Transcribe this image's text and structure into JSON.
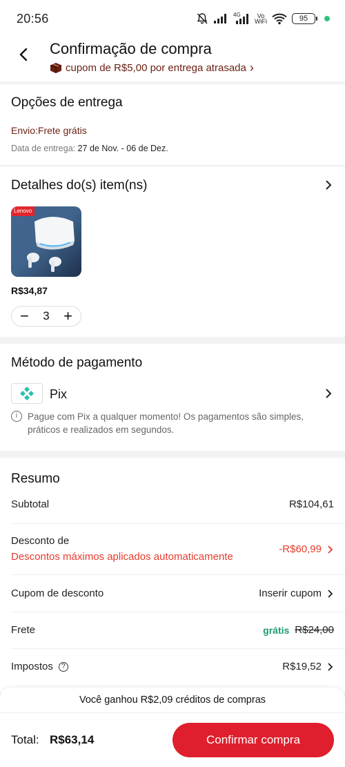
{
  "status_bar": {
    "time": "20:56",
    "network_label": "4G",
    "vowifi_top": "Vo",
    "vowifi_bottom": "WiFi",
    "battery": "95"
  },
  "header": {
    "title": "Confirmação de compra",
    "coupon_text": "cupom de R$5,00 por entrega atrasada",
    "coupon_chevron": "›"
  },
  "delivery": {
    "title": "Opções de entrega",
    "shipping": "Envio:Frete grátis",
    "date_label": "Data de entrega:",
    "date_value": "27 de Nov. - 06 de Dez."
  },
  "items": {
    "title": "Detalhes do(s) item(ns)",
    "product_brand": "Lenovo",
    "price": "R$34,87",
    "quantity": "3",
    "minus": "−",
    "plus": "+"
  },
  "payment": {
    "title": "Método de pagamento",
    "method": "Pix",
    "info": "Pague com Pix a qualquer momento! Os pagamentos são simples, práticos e realizados em segundos."
  },
  "summary": {
    "title": "Resumo",
    "subtotal_label": "Subtotal",
    "subtotal_value": "R$104,61",
    "discount_label": "Desconto de",
    "discount_note": "Descontos máximos aplicados automaticamente",
    "discount_value": "-R$60,99",
    "coupon_label": "Cupom de desconto",
    "coupon_value": "Inserir cupom",
    "shipping_label": "Frete",
    "shipping_free": "grátis",
    "shipping_old": "R$24,00",
    "taxes_label": "Impostos",
    "taxes_value": "R$19,52"
  },
  "credits_banner": "Você ganhou R$2,09 créditos de compras",
  "bottom": {
    "total_label": "Total:",
    "total_value": "R$63,14",
    "confirm_label": "Confirmar compra"
  },
  "colors": {
    "accent_red": "#df1f2d",
    "discount_red": "#e63b2e",
    "brand_brown": "#6a1f13",
    "free_green": "#1e9b6b",
    "pix_teal": "#32bcad"
  }
}
